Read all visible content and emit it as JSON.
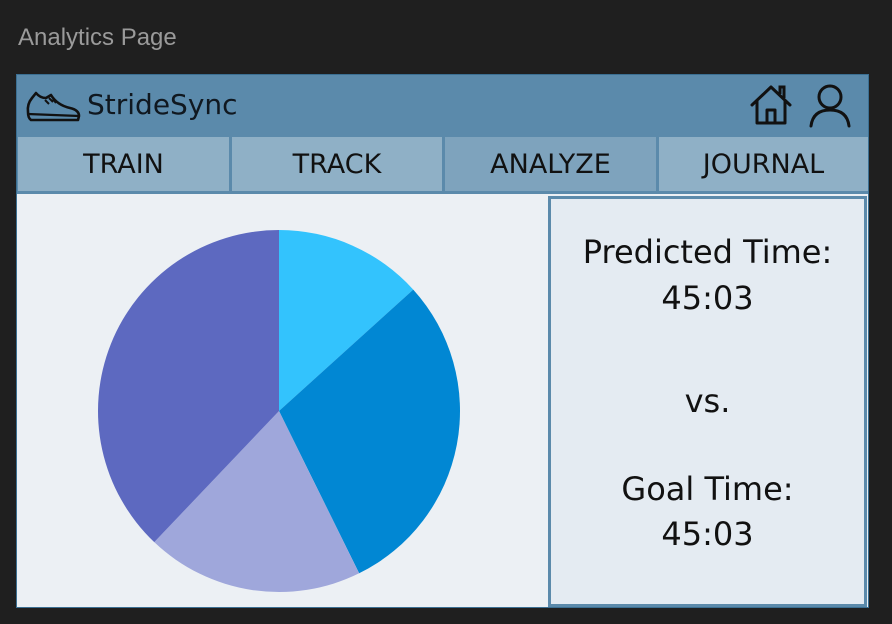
{
  "page_label": "Analytics Page",
  "header": {
    "brand": "StrideSync"
  },
  "nav": {
    "tabs": [
      {
        "label": "TRAIN"
      },
      {
        "label": "TRACK"
      },
      {
        "label": "ANALYZE"
      },
      {
        "label": "JOURNAL"
      }
    ]
  },
  "info": {
    "predicted_label": "Predicted Time:",
    "predicted_value": "45:03",
    "vs": "vs.",
    "goal_label": "Goal Time:",
    "goal_value": "45:03"
  },
  "colors": {
    "header_bg": "#5b8aab",
    "tab_bg": "#8fb0c6",
    "tab_active_bg": "#7ea3bd",
    "panel_bg": "#ecf0f4",
    "info_bg": "#e4ebf2"
  },
  "chart_data": {
    "type": "pie",
    "values": [
      0.133,
      0.294,
      0.194,
      0.379
    ],
    "colors": [
      "#33c3fd",
      "#0187d3",
      "#9fa7db",
      "#5d69c0"
    ]
  }
}
